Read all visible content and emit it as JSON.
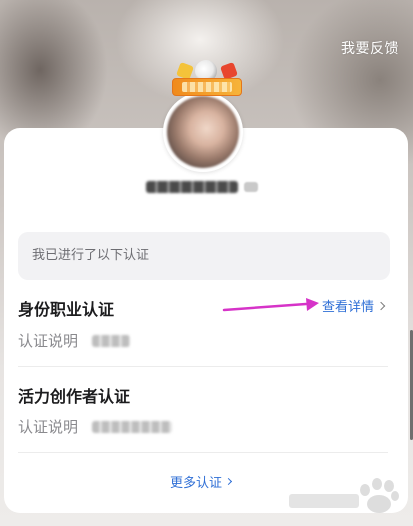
{
  "header": {
    "feedback_label": "我要反馈"
  },
  "summary": {
    "text": "我已进行了以下认证"
  },
  "certifications": [
    {
      "title": "身份职业认证",
      "detail_label": "查看详情",
      "row_label": "认证说明"
    },
    {
      "title": "活力创作者认证",
      "row_label": "认证说明"
    }
  ],
  "footer": {
    "more_label": "更多认证"
  },
  "colors": {
    "accent": "#2f6fd6",
    "annotation_arrow": "#d633c8",
    "badge": "#f08a1c"
  },
  "icons": {
    "detail_chevron": "chevron-right-icon",
    "more_chevron": "chevron-right-icon",
    "annotation": "arrow-right-icon"
  }
}
